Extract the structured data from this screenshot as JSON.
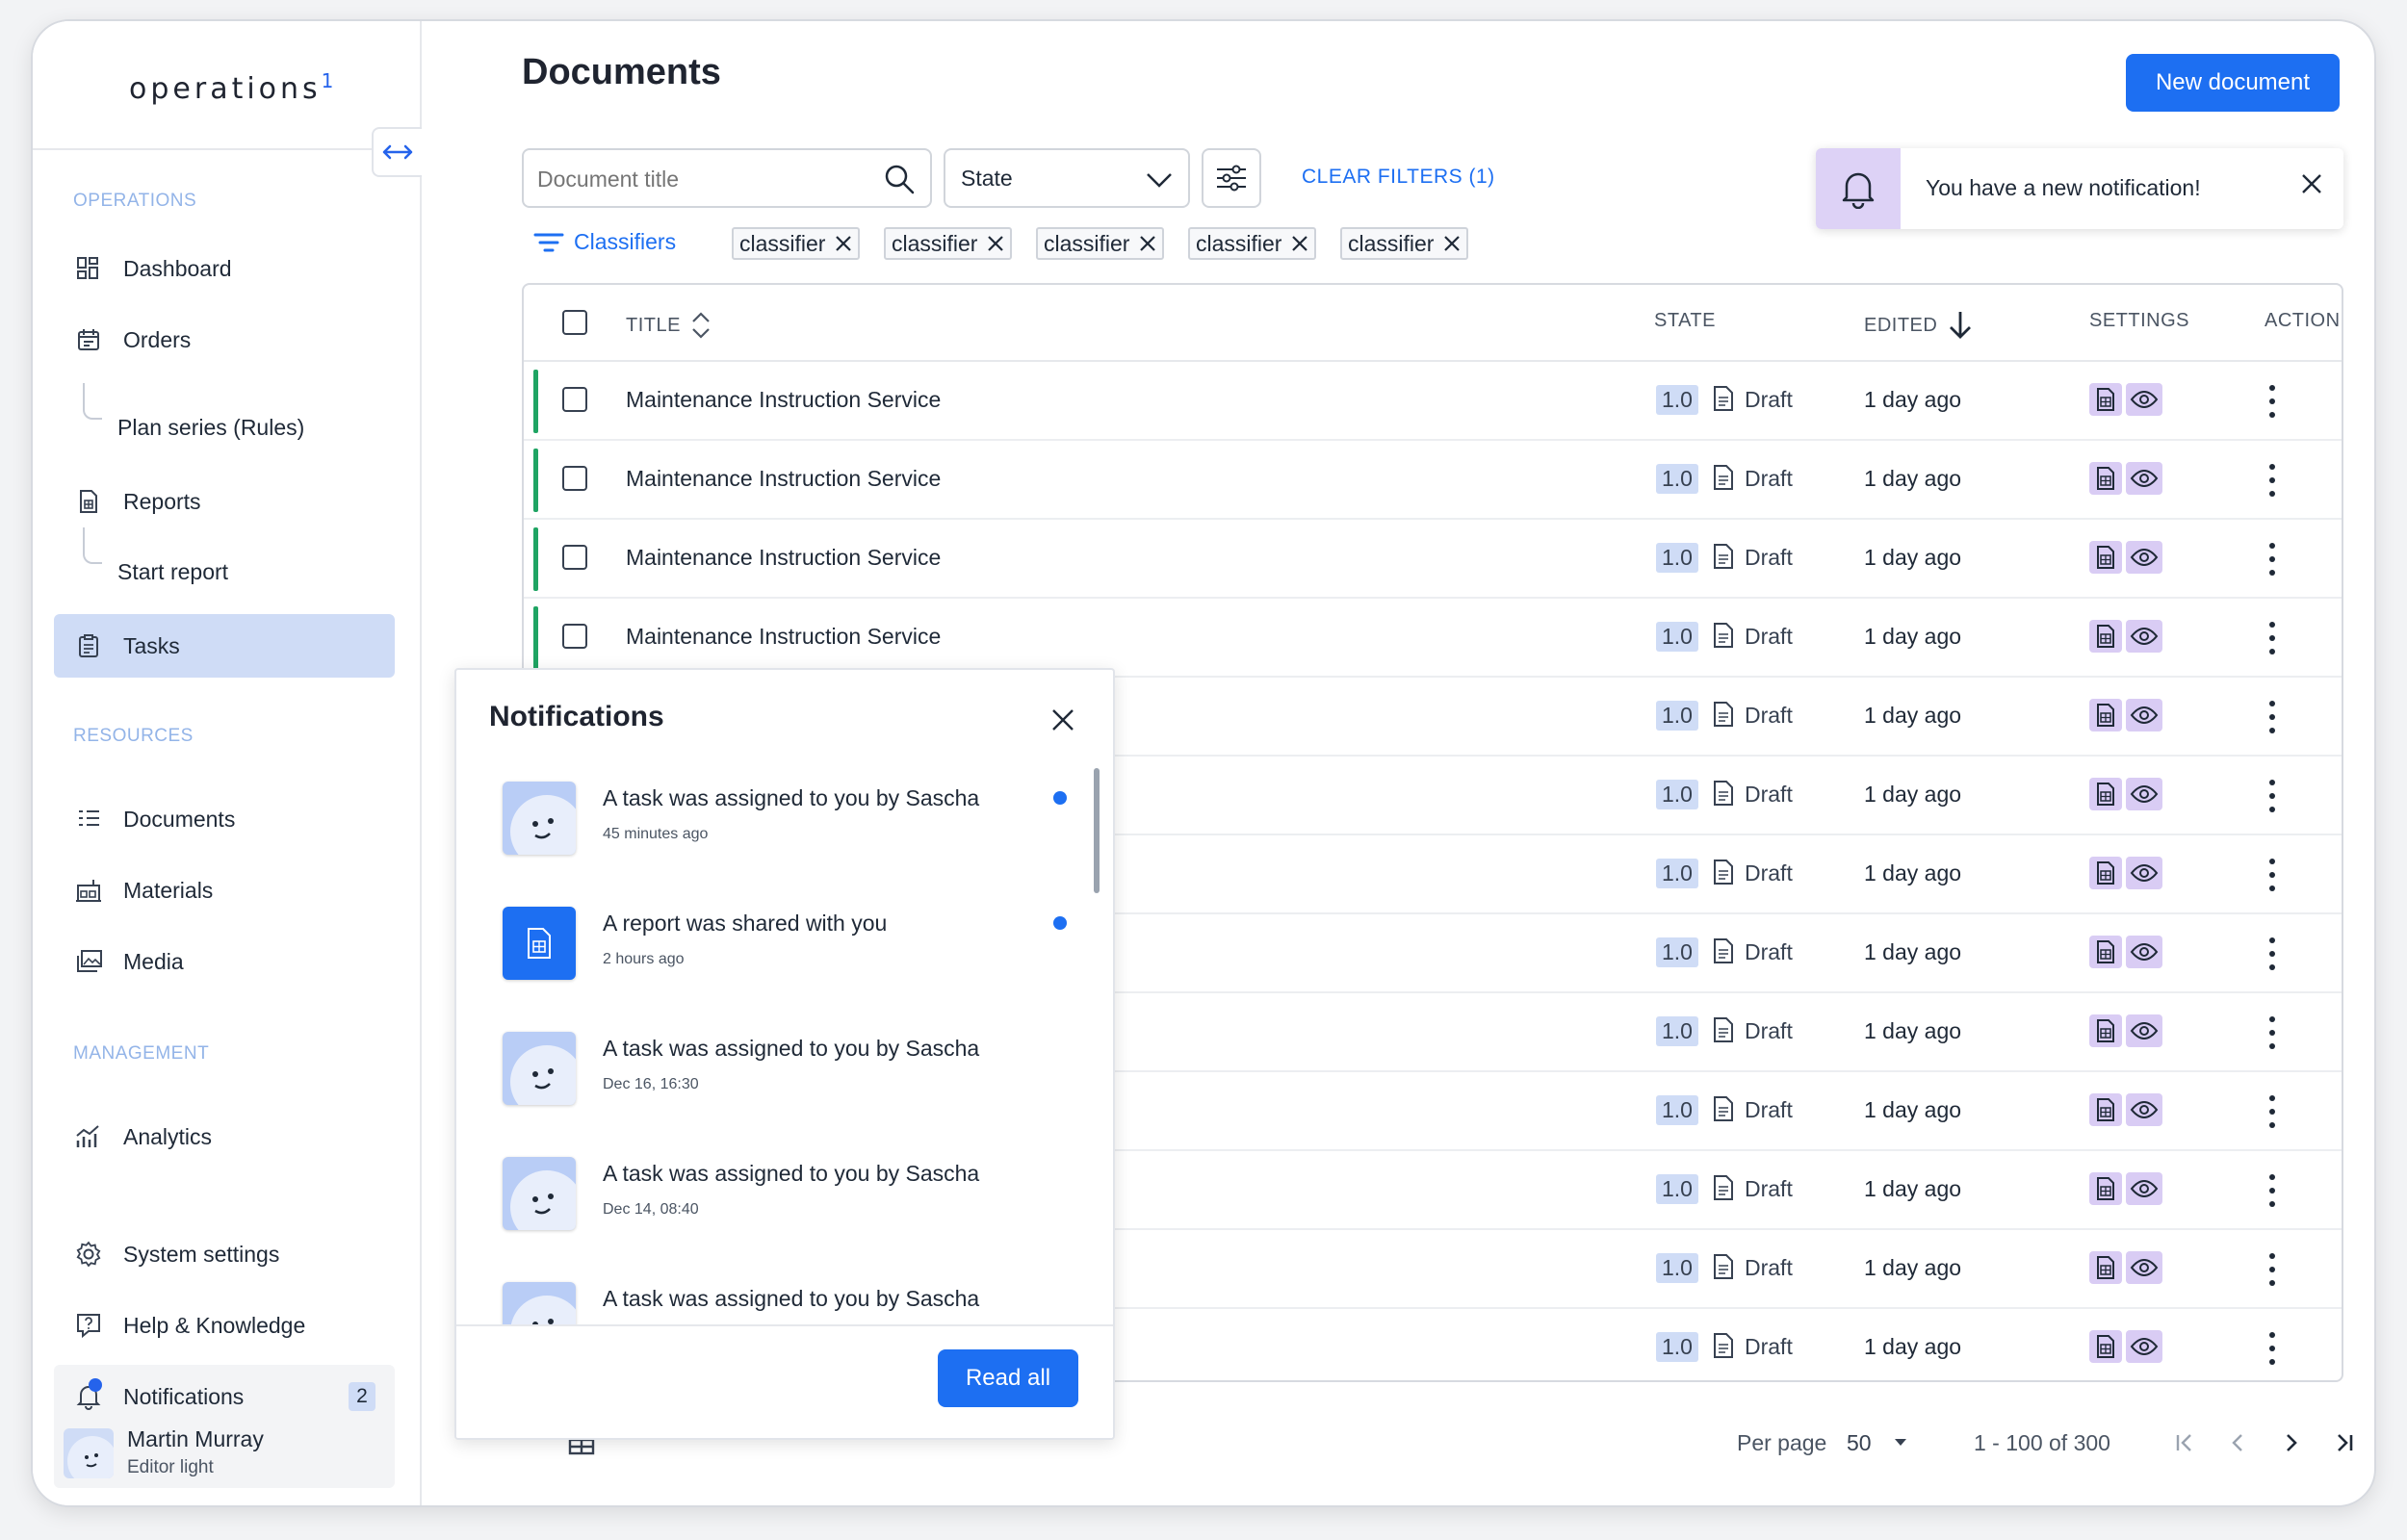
{
  "app": {
    "logo": "operations",
    "logo_mark": "1"
  },
  "sidebar": {
    "sections": [
      {
        "label": "OPERATIONS"
      },
      {
        "label": "RESOURCES"
      },
      {
        "label": "MANAGEMENT"
      }
    ],
    "items": {
      "dashboard": "Dashboard",
      "orders": "Orders",
      "plan_series": "Plan series (Rules)",
      "reports": "Reports",
      "start_report": "Start report",
      "tasks": "Tasks",
      "documents": "Documents",
      "materials": "Materials",
      "media": "Media",
      "analytics": "Analytics",
      "system_settings": "System settings",
      "help": "Help & Knowledge",
      "notifications": "Notifications",
      "notifications_count": "2"
    },
    "user": {
      "name": "Martin Murray",
      "role": "Editor light"
    },
    "active_item": "Tasks",
    "accent": "#2563eb"
  },
  "page": {
    "title": "Documents",
    "new_button": "New document"
  },
  "filters": {
    "search_placeholder": "Document title",
    "search_value": "",
    "state_label": "State",
    "clear_filters": "CLEAR FILTERS (1)",
    "classifiers_label": "Classifiers",
    "chips": [
      "classifier",
      "classifier",
      "classifier",
      "classifier",
      "classifier"
    ]
  },
  "toast": {
    "message": "You have a new notification!"
  },
  "table": {
    "headers": {
      "title": "TITLE",
      "state": "STATE",
      "edited": "EDITED",
      "settings": "SETTINGS",
      "action": "ACTION"
    },
    "rows": [
      {
        "title": "Maintenance Instruction Service",
        "version": "1.0",
        "state": "Draft",
        "edited": "1 day ago"
      },
      {
        "title": "Maintenance Instruction Service",
        "version": "1.0",
        "state": "Draft",
        "edited": "1 day ago"
      },
      {
        "title": "Maintenance Instruction Service",
        "version": "1.0",
        "state": "Draft",
        "edited": "1 day ago"
      },
      {
        "title": "Maintenance Instruction Service",
        "version": "1.0",
        "state": "Draft",
        "edited": "1 day ago"
      },
      {
        "title": "",
        "version": "1.0",
        "state": "Draft",
        "edited": "1 day ago"
      },
      {
        "title": "",
        "version": "1.0",
        "state": "Draft",
        "edited": "1 day ago"
      },
      {
        "title": "",
        "version": "1.0",
        "state": "Draft",
        "edited": "1 day ago"
      },
      {
        "title": "",
        "version": "1.0",
        "state": "Draft",
        "edited": "1 day ago"
      },
      {
        "title": "",
        "version": "1.0",
        "state": "Draft",
        "edited": "1 day ago"
      },
      {
        "title": "",
        "version": "1.0",
        "state": "Draft",
        "edited": "1 day ago"
      },
      {
        "title": "",
        "version": "1.0",
        "state": "Draft",
        "edited": "1 day ago"
      },
      {
        "title": "",
        "version": "1.0",
        "state": "Draft",
        "edited": "1 day ago"
      },
      {
        "title": "",
        "version": "1.0",
        "state": "Draft",
        "edited": "1 day ago"
      }
    ]
  },
  "pagination": {
    "per_page_label": "Per page",
    "per_page_value": "50",
    "range": "1 - 100 of 300"
  },
  "notifications": {
    "title": "Notifications",
    "read_all": "Read all",
    "items": [
      {
        "message": "A task was assigned to you by Sascha",
        "time": "45 minutes ago",
        "unread": true,
        "kind": "avatar"
      },
      {
        "message": "A report was shared with you",
        "time": "2 hours ago",
        "unread": true,
        "kind": "document"
      },
      {
        "message": "A task was assigned to you by Sascha",
        "time": "Dec 16, 16:30",
        "unread": false,
        "kind": "avatar"
      },
      {
        "message": "A task was assigned to you by Sascha",
        "time": "Dec 14, 08:40",
        "unread": false,
        "kind": "avatar"
      },
      {
        "message": "A task was assigned to you by Sascha",
        "time": "",
        "unread": false,
        "kind": "avatar"
      }
    ]
  },
  "colors": {
    "primary": "#1d6ff2",
    "active_bg": "#cfdcf6",
    "draft_bar": "#1fa463",
    "settings_bg": "#d9ccf4"
  }
}
